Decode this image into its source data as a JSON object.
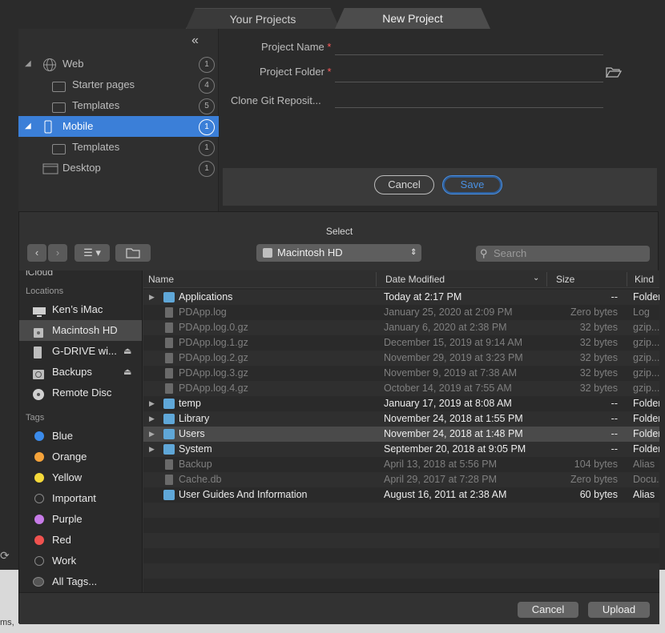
{
  "tabs": [
    "Your Projects",
    "New Project"
  ],
  "project_tree": [
    {
      "label": "Web",
      "count": "1",
      "icon": "globe-icon",
      "level": 0,
      "expanded": true
    },
    {
      "label": "Starter pages",
      "count": "4",
      "icon": "folder-icon",
      "level": 1
    },
    {
      "label": "Templates",
      "count": "5",
      "icon": "folder-icon",
      "level": 1
    },
    {
      "label": "Mobile",
      "count": "1",
      "icon": "phone-icon",
      "level": 0,
      "expanded": true,
      "selected": true
    },
    {
      "label": "Templates",
      "count": "1",
      "icon": "folder-icon",
      "level": 1
    },
    {
      "label": "Desktop",
      "count": "1",
      "icon": "desktop-icon",
      "level": 0
    }
  ],
  "form": {
    "project_name_label": "Project Name",
    "project_folder_label": "Project Folder",
    "clone_git_label": "Clone Git Reposit...",
    "required_mark": "*",
    "cancel": "Cancel",
    "save": "Save"
  },
  "dialog": {
    "title": "Select",
    "location": "Macintosh HD",
    "search_placeholder": "Search",
    "sidebar": {
      "icloud_label": "iCloud",
      "locations_header": "Locations",
      "locations": [
        {
          "label": "Ken’s iMac",
          "icon": "computer-icon"
        },
        {
          "label": "Macintosh HD",
          "icon": "disk-icon",
          "selected": true
        },
        {
          "label": "G-DRIVE wi...",
          "icon": "drive-icon",
          "eject": true
        },
        {
          "label": "Backups",
          "icon": "time-machine-icon",
          "eject": true
        },
        {
          "label": "Remote Disc",
          "icon": "disc-icon"
        }
      ],
      "tags_header": "Tags",
      "tags": [
        {
          "label": "Blue",
          "color": "#3b8beb"
        },
        {
          "label": "Orange",
          "color": "#f5a33a"
        },
        {
          "label": "Yellow",
          "color": "#f5d93a"
        },
        {
          "label": "Important",
          "color": "outline"
        },
        {
          "label": "Purple",
          "color": "#c77be8"
        },
        {
          "label": "Red",
          "color": "#f0524f"
        },
        {
          "label": "Work",
          "color": "outline"
        },
        {
          "label": "All Tags...",
          "color": "multi"
        }
      ]
    },
    "columns": {
      "name": "Name",
      "date": "Date Modified",
      "size": "Size",
      "kind": "Kind"
    },
    "files": [
      {
        "name": "Applications",
        "date": "Today at 2:17 PM",
        "size": "--",
        "kind": "Folder",
        "type": "folder",
        "expandable": true,
        "dim": false
      },
      {
        "name": "PDApp.log",
        "date": "January 25, 2020 at 2:09 PM",
        "size": "Zero bytes",
        "kind": "Log File",
        "type": "file",
        "dim": true
      },
      {
        "name": "PDApp.log.0.gz",
        "date": "January 6, 2020 at 2:38 PM",
        "size": "32 bytes",
        "kind": "gzip...",
        "type": "file",
        "dim": true
      },
      {
        "name": "PDApp.log.1.gz",
        "date": "December 15, 2019 at 9:14 AM",
        "size": "32 bytes",
        "kind": "gzip...",
        "type": "file",
        "dim": true
      },
      {
        "name": "PDApp.log.2.gz",
        "date": "November 29, 2019 at 3:23 PM",
        "size": "32 bytes",
        "kind": "gzip...",
        "type": "file",
        "dim": true
      },
      {
        "name": "PDApp.log.3.gz",
        "date": "November 9, 2019 at 7:38 AM",
        "size": "32 bytes",
        "kind": "gzip...",
        "type": "file",
        "dim": true
      },
      {
        "name": "PDApp.log.4.gz",
        "date": "October 14, 2019 at 7:55 AM",
        "size": "32 bytes",
        "kind": "gzip...",
        "type": "file",
        "dim": true
      },
      {
        "name": "temp",
        "date": "January 17, 2019 at 8:08 AM",
        "size": "--",
        "kind": "Folder",
        "type": "folder",
        "expandable": true,
        "dim": false
      },
      {
        "name": "Library",
        "date": "November 24, 2018 at 1:55 PM",
        "size": "--",
        "kind": "Folder",
        "type": "folder",
        "expandable": true,
        "dim": false
      },
      {
        "name": "Users",
        "date": "November 24, 2018 at 1:48 PM",
        "size": "--",
        "kind": "Folder",
        "type": "folder",
        "expandable": true,
        "dim": false,
        "selected": true
      },
      {
        "name": "System",
        "date": "September 20, 2018 at 9:05 PM",
        "size": "--",
        "kind": "Folder",
        "type": "folder",
        "expandable": true,
        "dim": false
      },
      {
        "name": "Backup",
        "date": "April 13, 2018 at 5:56 PM",
        "size": "104 bytes",
        "kind": "Alias",
        "type": "file",
        "dim": true
      },
      {
        "name": "Cache.db",
        "date": "April 29, 2017 at 7:28 PM",
        "size": "Zero bytes",
        "kind": "Docu...",
        "type": "file",
        "dim": true
      },
      {
        "name": "User Guides And Information",
        "date": "August 16, 2011 at 2:38 AM",
        "size": "60 bytes",
        "kind": "Alias",
        "type": "folder",
        "dim": false
      }
    ],
    "cancel": "Cancel",
    "upload": "Upload"
  },
  "bottom_peek": "ms,"
}
